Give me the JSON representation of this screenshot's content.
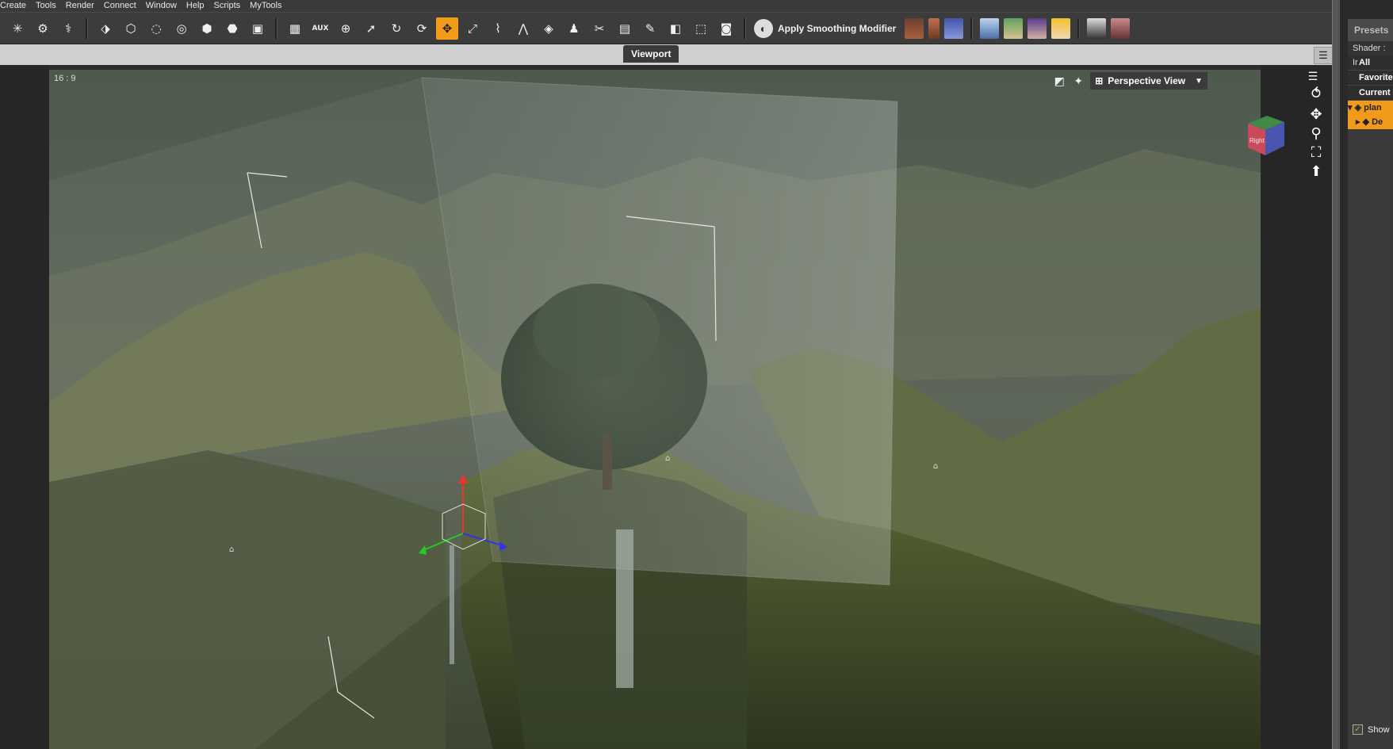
{
  "menubar": {
    "items": [
      "Create",
      "Tools",
      "Render",
      "Connect",
      "Window",
      "Help",
      "Scripts",
      "MyTools"
    ]
  },
  "toolbar": {
    "smoothing_label": "Apply Smoothing Modifier",
    "aux_label": "AUX",
    "active_tool": "universal-tool"
  },
  "tabs": {
    "viewport_label": "Viewport"
  },
  "viewport": {
    "aspect_label": "16 : 9",
    "view_label": "Perspective View",
    "navcube_face_label": "Right"
  },
  "right_panel": {
    "header": "Presets",
    "shader_label": "Shader : Ir",
    "filters": [
      "All",
      "Favorite",
      "Current"
    ],
    "tree": [
      "plan",
      "De"
    ],
    "show_label": "Show"
  },
  "colors": {
    "accent": "#f29a1a",
    "panel": "#3a3a3a",
    "tabstrip": "#cfcfcf"
  }
}
